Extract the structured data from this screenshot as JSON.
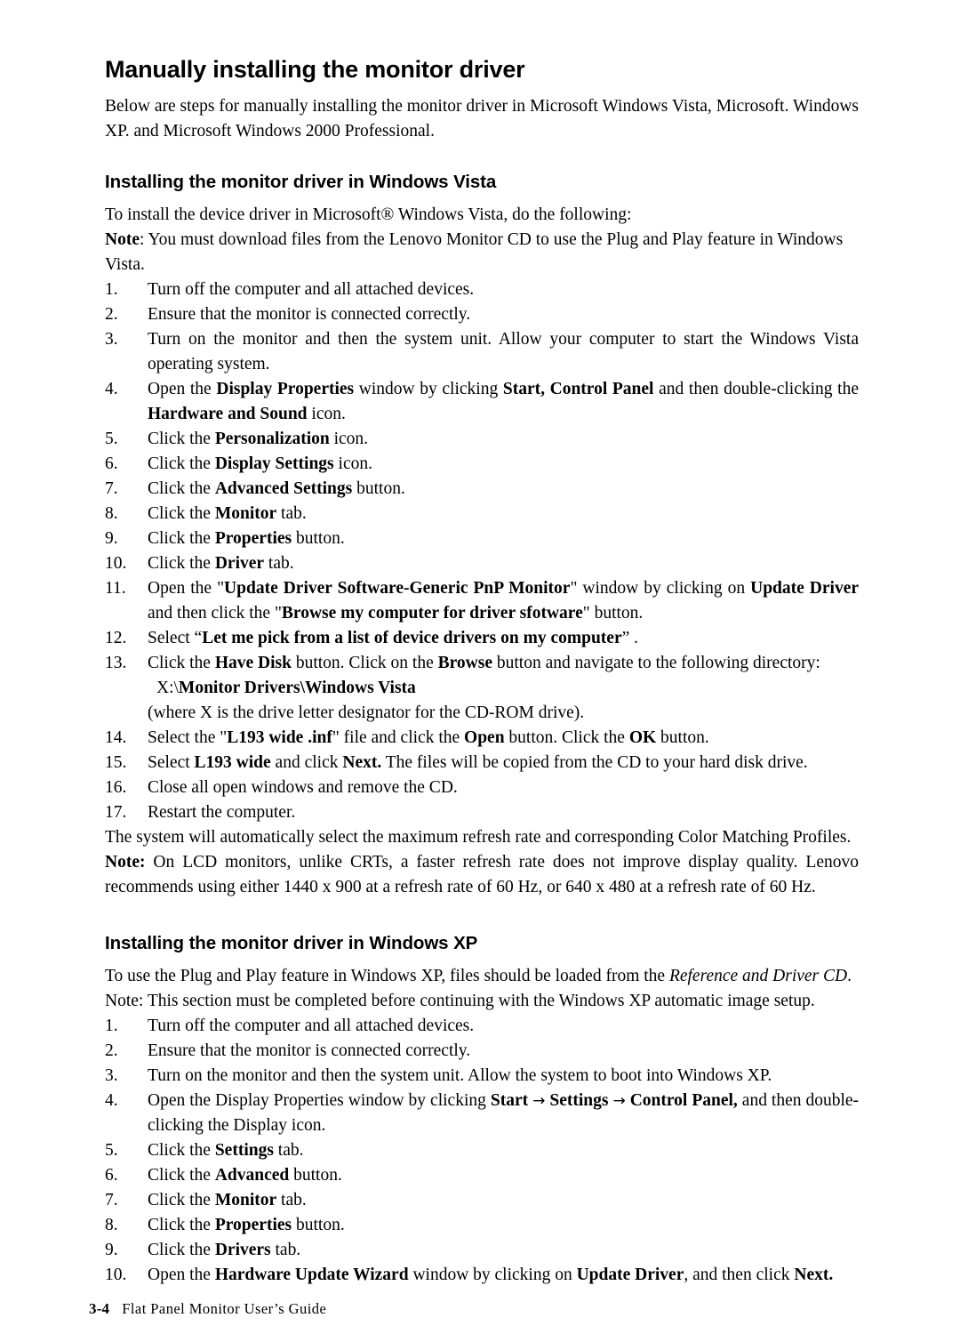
{
  "document": {
    "title": "Manually installing the monitor driver",
    "intro": "Below are steps for manually installing the monitor driver in Microsoft Windows Vista, Microsoft. Windows XP. and Microsoft Windows 2000 Professional."
  },
  "vista": {
    "heading": "Installing the monitor driver in Windows Vista",
    "lead": "To install the device driver in Microsoft® Windows Vista, do the following:",
    "note_label": "Note",
    "note_text": ": You must download files from the Lenovo Monitor CD to use the Plug and Play feature in Windows Vista.",
    "steps": [
      {
        "num": "1.",
        "text": "Turn off the computer and all attached devices."
      },
      {
        "num": "2.",
        "text": "Ensure that the monitor is connected correctly."
      },
      {
        "num": "3.",
        "text": "Turn on the monitor and then the system unit. Allow your computer to start the Windows Vista operating system."
      },
      {
        "num": "4.",
        "t1": "Open the ",
        "b1": "Display Properties",
        "t2": " window by clicking ",
        "b2": "Start, Control Panel",
        "t3": " and then double-clicking the ",
        "b3": "Hardware and Sound",
        "t4": " icon."
      },
      {
        "num": "5.",
        "t1": "Click the ",
        "b1": "Personalization",
        "t2": " icon."
      },
      {
        "num": "6.",
        "t1": "Click the ",
        "b1": "Display Settings",
        "t2": " icon."
      },
      {
        "num": "7.",
        "t1": "Click the ",
        "b1": "Advanced Settings",
        "t2": " button."
      },
      {
        "num": "8.",
        "t1": "Click the ",
        "b1": "Monitor",
        "t2": " tab."
      },
      {
        "num": "9.",
        "t1": "Click the ",
        "b1": "Properties",
        "t2": " button."
      },
      {
        "num": "10.",
        "t1": "Click the ",
        "b1": "Driver",
        "t2": " tab."
      },
      {
        "num": "11.",
        "t1": "Open the \"",
        "b1": "Update Driver Software-Generic PnP Monitor",
        "t2": "\" window by clicking on ",
        "b2": "Update Driver",
        "t3": " and then click the \"",
        "b3": "Browse my computer for driver sfotware",
        "t4": "\" button."
      },
      {
        "num": "12.",
        "t1": "Select “",
        "b1": "Let me pick from a list of device drivers on my computer",
        "t2": "”   ."
      },
      {
        "num": "13.",
        "t1": "Click the ",
        "b1": "Have Disk",
        "t2": " button. Click on the ",
        "b2": "Browse",
        "t3": " button and navigate to the following directory:",
        "sub_plain": "X:\\",
        "sub_bold": "Monitor Drivers\\Windows Vista",
        "sub2": "(where X is the drive letter designator for the CD-ROM drive)."
      },
      {
        "num": "14.",
        "t1": "Select the \"",
        "b1": "L193 wide .inf",
        "t2": "\" file and click the ",
        "b2": "Open",
        "t3": " button. Click the ",
        "b3": "OK",
        "t4": " button."
      },
      {
        "num": "15.",
        "t1": "Select  ",
        "b1": "L193 wide",
        "t2": " and click ",
        "b2": "Next.",
        "t3": " The files will be copied from the CD to your hard disk drive."
      },
      {
        "num": "16.",
        "text": "Close all open windows and remove the CD."
      },
      {
        "num": "17.",
        "text": "Restart the computer."
      }
    ],
    "closing": "The system will automatically select the maximum refresh rate and corresponding Color Matching Profiles.",
    "closing_note_label": "Note:",
    "closing_note_text": " On LCD monitors, unlike CRTs, a faster refresh rate does not improve display quality. Lenovo recommends using either 1440 x 900 at a refresh rate of 60 Hz, or 640 x 480 at a refresh rate of 60 Hz."
  },
  "xp": {
    "heading": "Installing the monitor driver in Windows XP",
    "lead_t1": "To use the Plug and Play feature in Windows XP, files should be loaded from the ",
    "lead_i1": "Reference and Driver CD",
    "lead_t2": ".",
    "note": "Note: This section must be completed before continuing with the Windows XP automatic image setup.",
    "steps": [
      {
        "num": "1.",
        "text": "Turn off the computer and all attached devices."
      },
      {
        "num": "2.",
        "text": "Ensure that the monitor is connected correctly."
      },
      {
        "num": "3.",
        "text": "Turn on the monitor and then the system unit. Allow the system to boot into Windows XP."
      },
      {
        "num": "4.",
        "t1": "Open the Display Properties window by clicking ",
        "b1": "Start",
        "arrow1": "→",
        "b2": "Settings",
        "arrow2": "→",
        "b3": "Control  Panel,",
        "t2": " and then double-clicking the Display icon."
      },
      {
        "num": "5.",
        "t1": "Click the ",
        "b1": "Settings",
        "t2": " tab."
      },
      {
        "num": "6.",
        "t1": "Click the ",
        "b1": "Advanced",
        "t2": " button."
      },
      {
        "num": "7.",
        "t1": "Click the ",
        "b1": "Monitor",
        "t2": " tab."
      },
      {
        "num": "8.",
        "t1": "Click the ",
        "b1": "Properties",
        "t2": " button."
      },
      {
        "num": "9.",
        "t1": "Click the ",
        "b1": "Drivers",
        "t2": " tab."
      },
      {
        "num": "10.",
        "t1": "Open the ",
        "b1": "Hardware Update Wizard",
        "t2": " window by clicking on ",
        "b2": "Update Driver",
        "t3": ", and then click ",
        "b3": "Next."
      }
    ]
  },
  "footer": {
    "page_number": "3-4",
    "guide_title": "Flat Panel Monitor User’s Guide"
  }
}
